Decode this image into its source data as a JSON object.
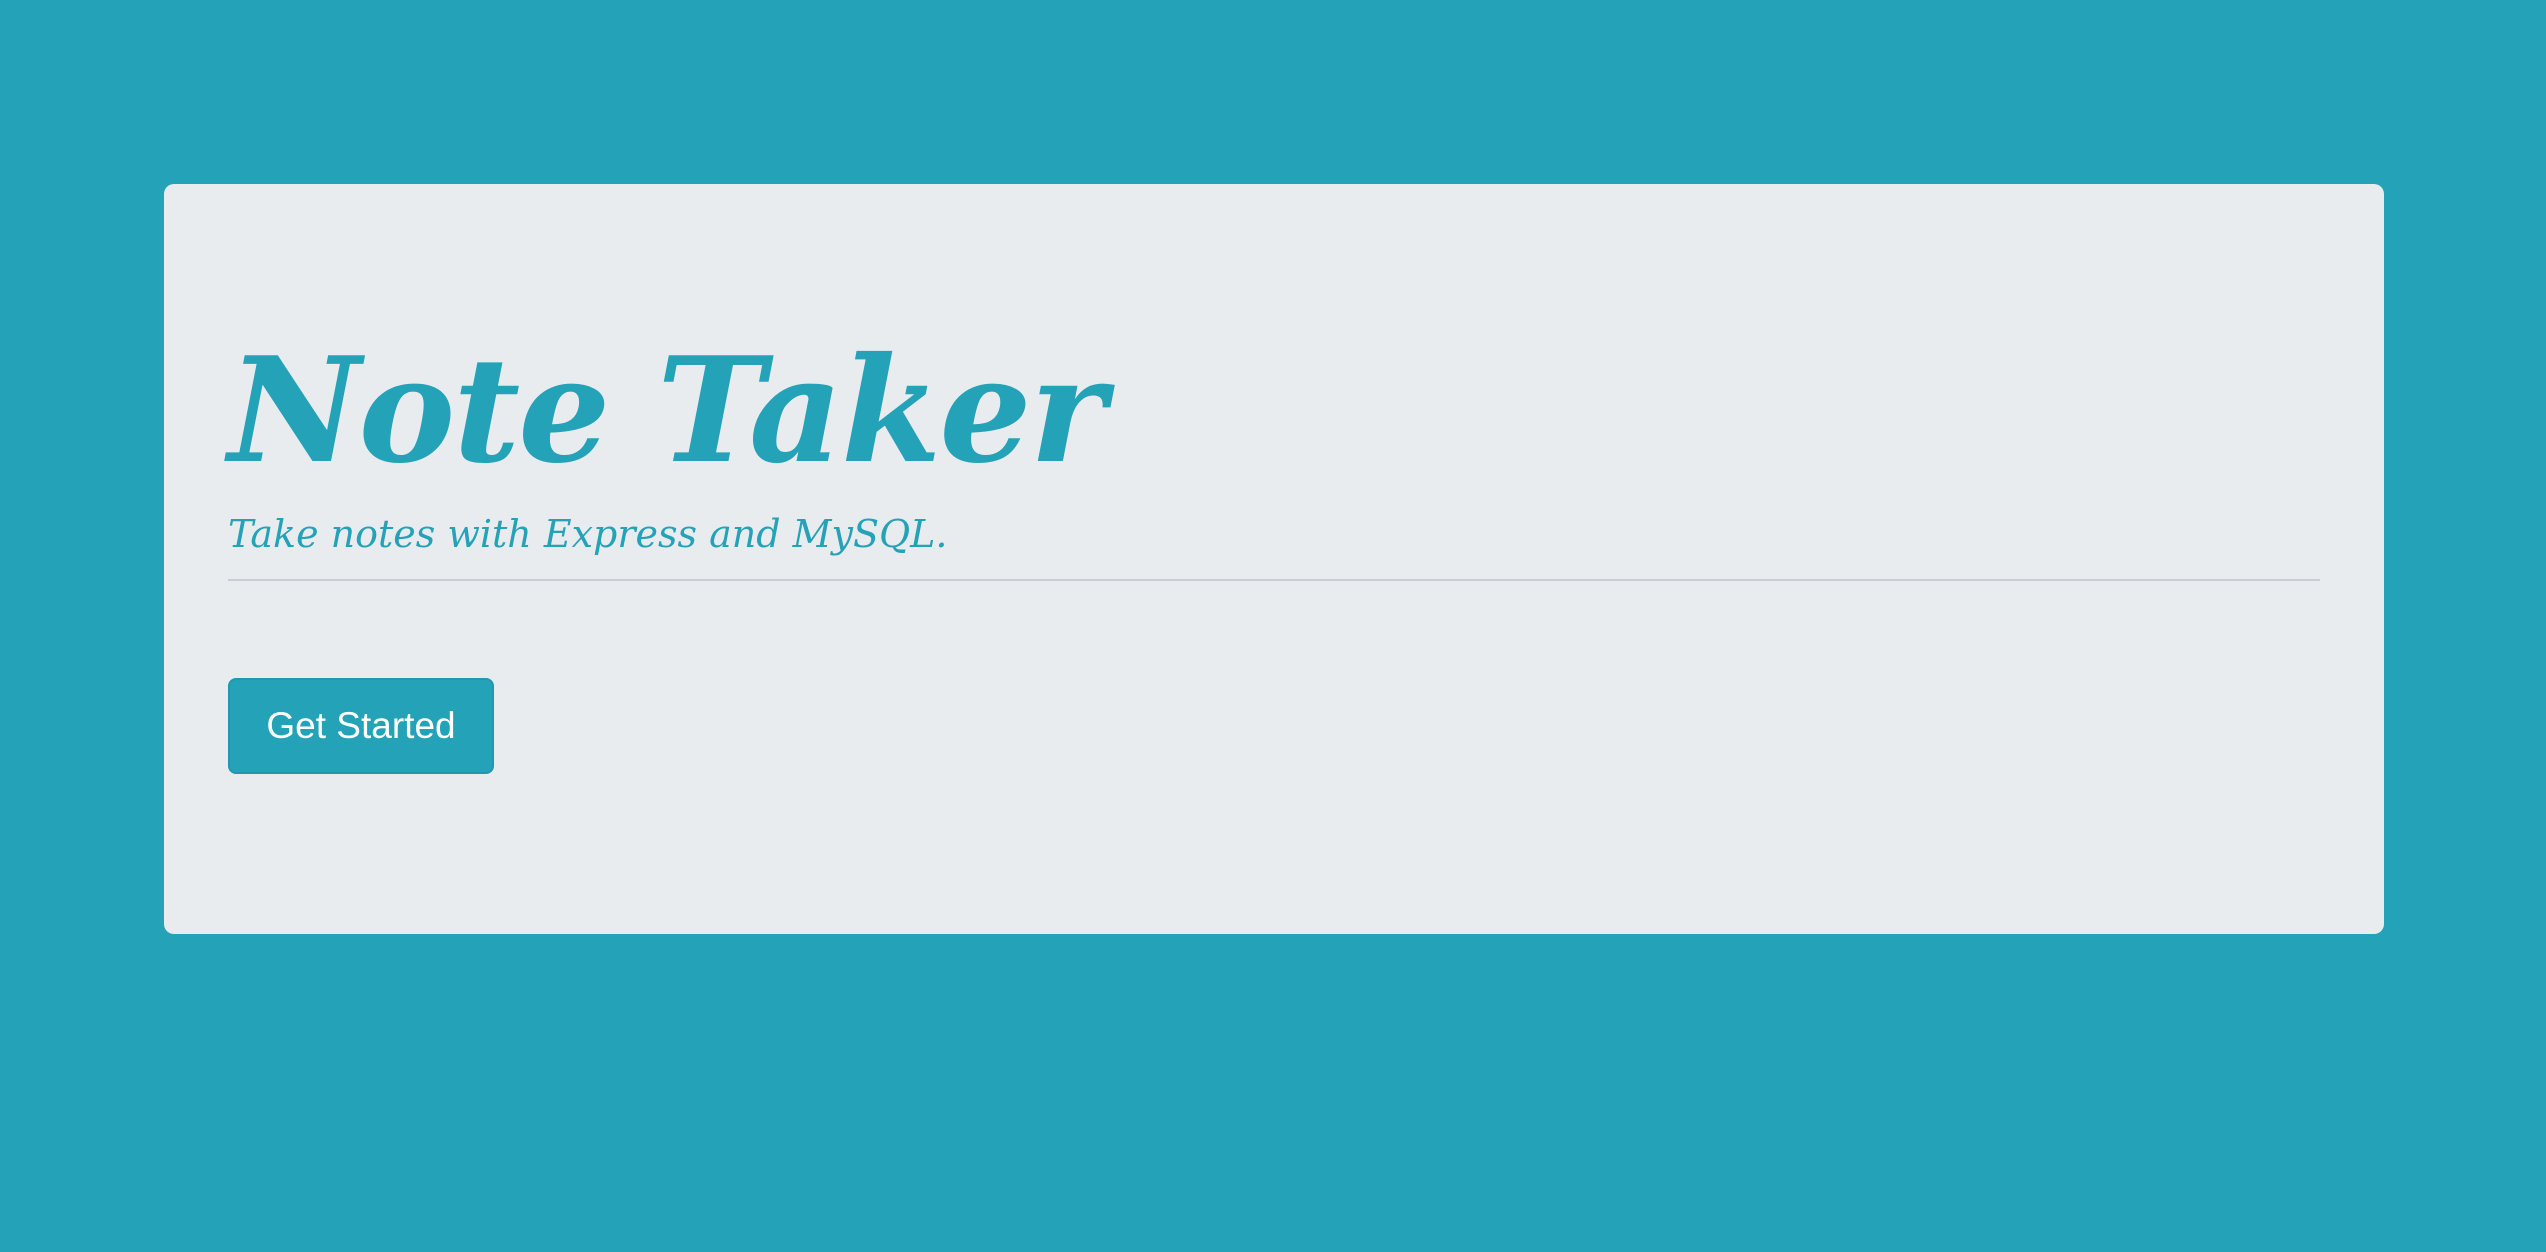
{
  "hero": {
    "title": "Note Taker",
    "subtitle": "Take notes with Express and MySQL.",
    "button_label": "Get Started"
  },
  "colors": {
    "background": "#24a2b8",
    "panel": "#e9ecef",
    "accent": "#24a2b8",
    "button_text": "#ffffff"
  }
}
